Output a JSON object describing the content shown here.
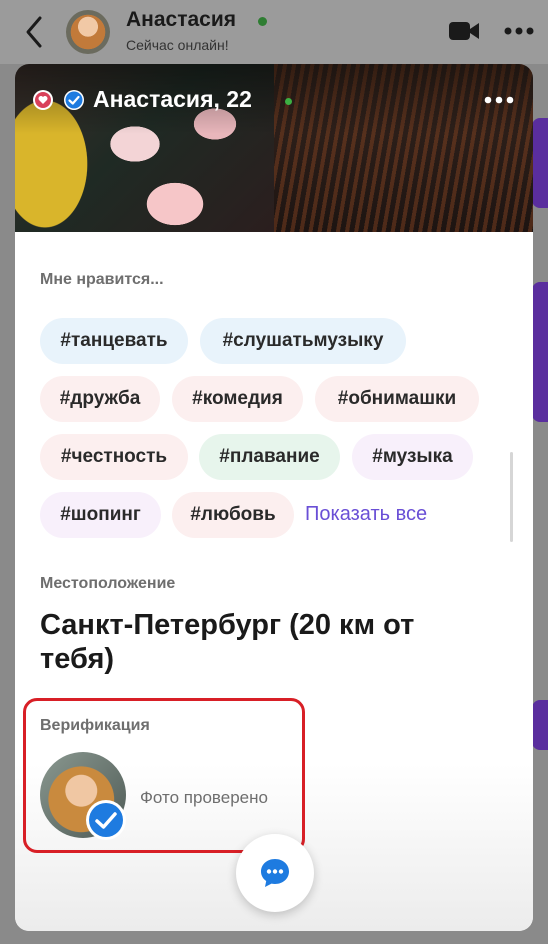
{
  "chat_header": {
    "name": "Анастасия",
    "status": "Сейчас онлайн!"
  },
  "profile": {
    "name_age": "Анастасия, 22",
    "likes_label": "Мне нравится...",
    "tags": [
      {
        "label": "#танцевать",
        "color": "#e8f3fb"
      },
      {
        "label": "#слушатьмузыку",
        "color": "#e8f3fb"
      },
      {
        "label": "#дружба",
        "color": "#fcefef"
      },
      {
        "label": "#комедия",
        "color": "#fcefef"
      },
      {
        "label": "#обнимашки",
        "color": "#fcefef"
      },
      {
        "label": "#честность",
        "color": "#fcefef"
      },
      {
        "label": "#плавание",
        "color": "#e7f5ec"
      },
      {
        "label": "#музыка",
        "color": "#f8f0fb"
      },
      {
        "label": "#шопинг",
        "color": "#f8f0fb"
      },
      {
        "label": "#любовь",
        "color": "#fcefef"
      }
    ],
    "show_all": "Показать все",
    "location_label": "Местоположение",
    "location_value": "Санкт-Петербург (20 км от тебя)",
    "verification_label": "Верификация",
    "verification_status": "Фото проверено"
  },
  "colors": {
    "accent": "#6a4fd6",
    "verified_blue": "#1e7be0",
    "online_green": "#3cb043",
    "highlight_red": "#d81f26"
  },
  "icons": {
    "back": "chevron-left-icon",
    "video": "video-camera-icon",
    "more": "more-dots-icon",
    "verified": "verified-check-icon",
    "chat": "chat-bubble-icon"
  }
}
